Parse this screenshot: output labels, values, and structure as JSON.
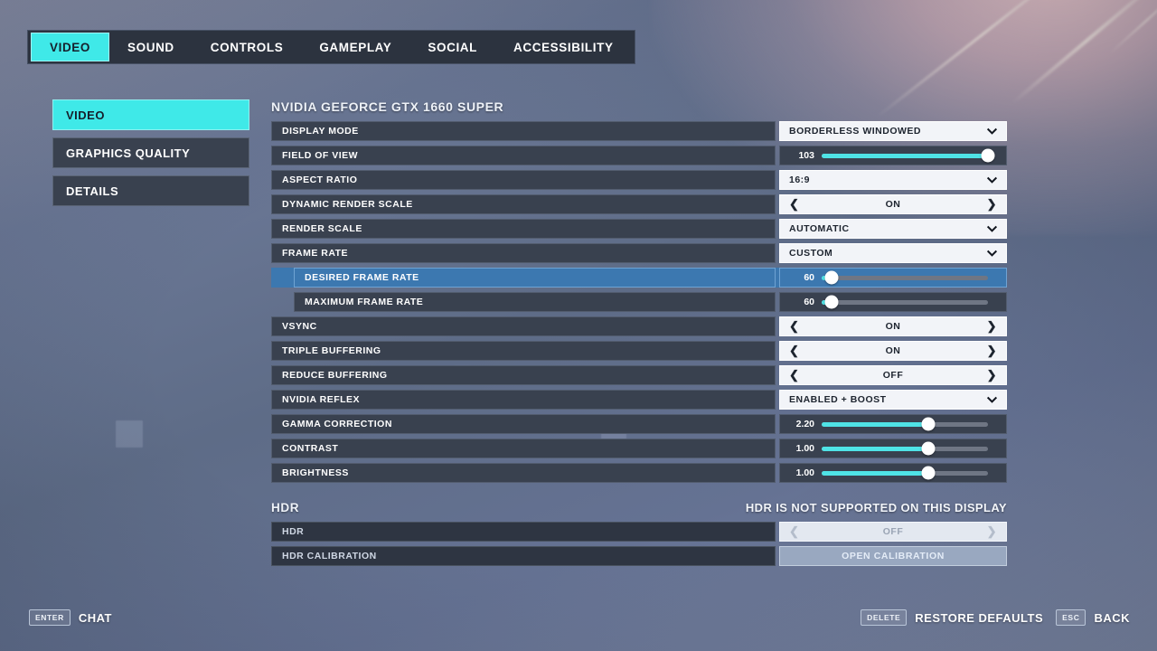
{
  "tabs": [
    {
      "label": "VIDEO",
      "active": true
    },
    {
      "label": "SOUND",
      "active": false
    },
    {
      "label": "CONTROLS",
      "active": false
    },
    {
      "label": "GAMEPLAY",
      "active": false
    },
    {
      "label": "SOCIAL",
      "active": false
    },
    {
      "label": "ACCESSIBILITY",
      "active": false
    }
  ],
  "sidebar": {
    "items": [
      {
        "label": "VIDEO",
        "active": true
      },
      {
        "label": "GRAPHICS QUALITY",
        "active": false
      },
      {
        "label": "DETAILS",
        "active": false
      }
    ]
  },
  "panel": {
    "gpu_title": "NVIDIA GEFORCE GTX 1660 SUPER",
    "rows": [
      {
        "label": "DISPLAY MODE",
        "type": "dropdown",
        "value": "BORDERLESS WINDOWED"
      },
      {
        "label": "FIELD OF VIEW",
        "type": "slider",
        "value": "103",
        "fill": 100
      },
      {
        "label": "ASPECT RATIO",
        "type": "dropdown",
        "value": "16:9"
      },
      {
        "label": "DYNAMIC RENDER SCALE",
        "type": "arrows",
        "value": "ON"
      },
      {
        "label": "RENDER SCALE",
        "type": "dropdown",
        "value": "AUTOMATIC"
      },
      {
        "label": "FRAME RATE",
        "type": "dropdown",
        "value": "CUSTOM"
      },
      {
        "label": "DESIRED FRAME RATE",
        "type": "slider",
        "value": "60",
        "fill": 6,
        "indent": true,
        "selected": true
      },
      {
        "label": "MAXIMUM FRAME RATE",
        "type": "slider",
        "value": "60",
        "fill": 6,
        "indent": true
      },
      {
        "label": "VSYNC",
        "type": "arrows",
        "value": "ON"
      },
      {
        "label": "TRIPLE BUFFERING",
        "type": "arrows",
        "value": "ON"
      },
      {
        "label": "REDUCE BUFFERING",
        "type": "arrows",
        "value": "OFF"
      },
      {
        "label": "NVIDIA REFLEX",
        "type": "dropdown",
        "value": "ENABLED + BOOST"
      },
      {
        "label": "GAMMA CORRECTION",
        "type": "slider",
        "value": "2.20",
        "fill": 64
      },
      {
        "label": "CONTRAST",
        "type": "slider",
        "value": "1.00",
        "fill": 64
      },
      {
        "label": "BRIGHTNESS",
        "type": "slider",
        "value": "1.00",
        "fill": 64
      }
    ]
  },
  "hdr": {
    "title": "HDR",
    "note": "HDR IS NOT SUPPORTED ON THIS DISPLAY",
    "rows": [
      {
        "label": "HDR",
        "type": "arrows",
        "value": "OFF",
        "disabled": true
      },
      {
        "label": "HDR CALIBRATION",
        "type": "button",
        "value": "OPEN CALIBRATION",
        "disabled": true
      }
    ]
  },
  "footer": {
    "left": [
      {
        "key": "ENTER",
        "label": "CHAT"
      }
    ],
    "right": [
      {
        "key": "DELETE",
        "label": "RESTORE DEFAULTS"
      },
      {
        "key": "ESC",
        "label": "BACK"
      }
    ]
  },
  "colors": {
    "accent_cyan": "#3fe9e8",
    "selected_blue": "#3c78b0",
    "row_dark": "#39414f",
    "control_light": "#f2f4f8",
    "background_blue": "#5e6c87"
  }
}
